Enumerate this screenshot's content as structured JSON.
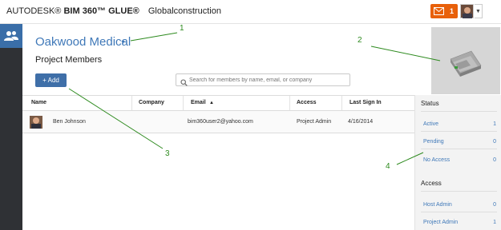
{
  "header": {
    "brand_prefix": "AUTODESK®",
    "brand_product": "BIM 360™ GLUE®",
    "project_group": "Globalconstruction",
    "notification_count": "1"
  },
  "main": {
    "project_name": "Oakwood Medical",
    "section_title": "Project Members",
    "add_label": "+ Add",
    "search_placeholder": "Search for members by name, email, or company"
  },
  "table": {
    "columns": [
      "Name",
      "Company",
      "Email",
      "Access",
      "Last Sign In"
    ],
    "sort_indicator": "▲",
    "rows": [
      {
        "name": "Ben Johnson",
        "company": "",
        "email": "bim360user2@yahoo.com",
        "access": "Project Admin",
        "last_sign_in": "4/16/2014"
      }
    ]
  },
  "status_panel": {
    "status_title": "Status",
    "status_items": [
      {
        "label": "Active",
        "count": "1"
      },
      {
        "label": "Pending",
        "count": "0"
      },
      {
        "label": "No Access",
        "count": "0"
      }
    ],
    "access_title": "Access",
    "access_items": [
      {
        "label": "Host Admin",
        "count": "0"
      },
      {
        "label": "Project Admin",
        "count": "1"
      }
    ]
  },
  "callouts": [
    "1",
    "2",
    "3",
    "4"
  ],
  "colors": {
    "accent_blue": "#3f78b8",
    "button_blue": "#3f6fa8",
    "notification_orange": "#e8600a",
    "rail_dark": "#2f3135",
    "callout_green": "#2d8a1e"
  },
  "icons": [
    "members-icon",
    "mail-icon",
    "search-icon",
    "chevron-down-icon",
    "sort-asc-icon"
  ]
}
